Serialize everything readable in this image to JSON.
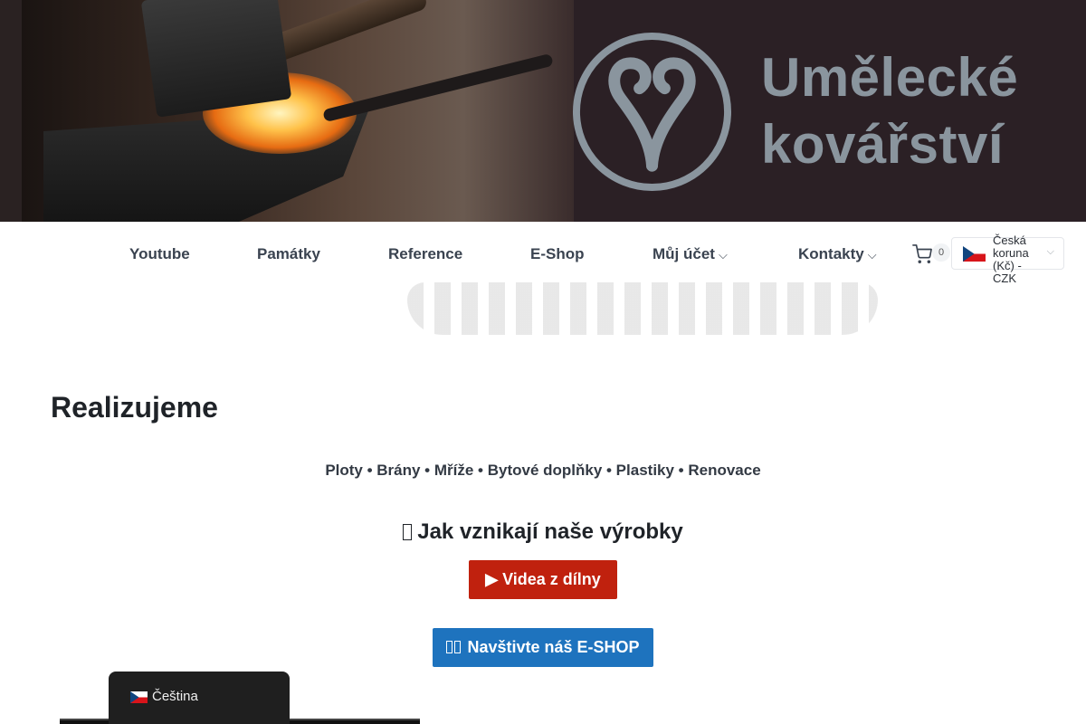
{
  "brand": {
    "line1": "Umělecké",
    "line2": "kovářství",
    "logo_icon": "stylized-aries-ram-logo",
    "logo_color": "#8a959e"
  },
  "nav": {
    "items": [
      {
        "label": "Youtube",
        "has_dropdown": false
      },
      {
        "label": "Památky",
        "has_dropdown": false
      },
      {
        "label": "Reference",
        "has_dropdown": false
      },
      {
        "label": "E-Shop",
        "has_dropdown": false
      },
      {
        "label": "Můj účet",
        "has_dropdown": true
      },
      {
        "label": "Kontakty",
        "has_dropdown": true
      }
    ],
    "cart": {
      "icon": "shopping-cart-icon",
      "count": "0"
    },
    "currency": {
      "line1": "Česká",
      "line2": "koruna",
      "line3": "(Kč) -",
      "line4": "CZK",
      "flag": "czech-flag-icon"
    }
  },
  "main": {
    "heading": "Realizujeme",
    "categories": "Ploty • Brány • Mříže • Bytové doplňky • Plastiky • Renovace",
    "subheading": "Jak vznikají naše výrobky",
    "video_button": "▶ Videa z dílny",
    "eshop_button": "Navštivte náš E-SHOP"
  },
  "language_switcher": {
    "label": "Čeština",
    "flag": "czech-flag-icon"
  },
  "colors": {
    "red_button": "#c0210e",
    "blue_button": "#1e73be",
    "nav_text": "#3a4350"
  }
}
